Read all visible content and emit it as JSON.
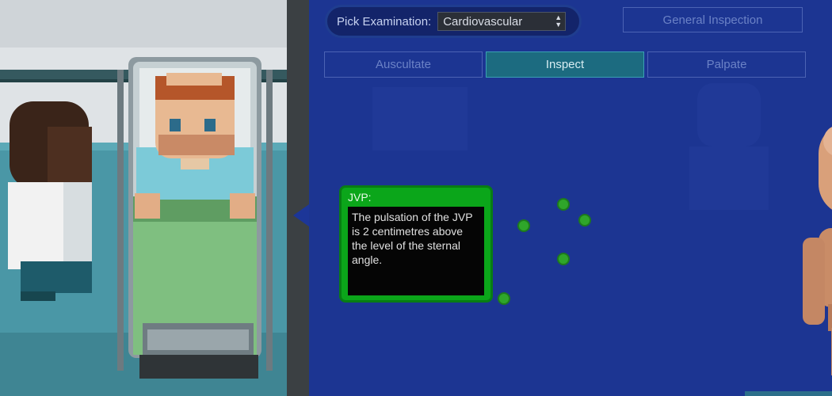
{
  "examination": {
    "label": "Pick Examination:",
    "selected": "Cardiovascular"
  },
  "buttons": {
    "general": "General Inspection",
    "auscultate": "Auscultate",
    "inspect": "Inspect",
    "palpate": "Palpate"
  },
  "tooltip": {
    "title": "JVP:",
    "body": "The pulsation of the JVP is 2 centimetres above the level of the sternal angle."
  },
  "colors": {
    "panel": "#1c3592",
    "active_button": "#1c6b80",
    "tooltip_green": "#0ba61a",
    "hotspot": "#2fa62a"
  }
}
